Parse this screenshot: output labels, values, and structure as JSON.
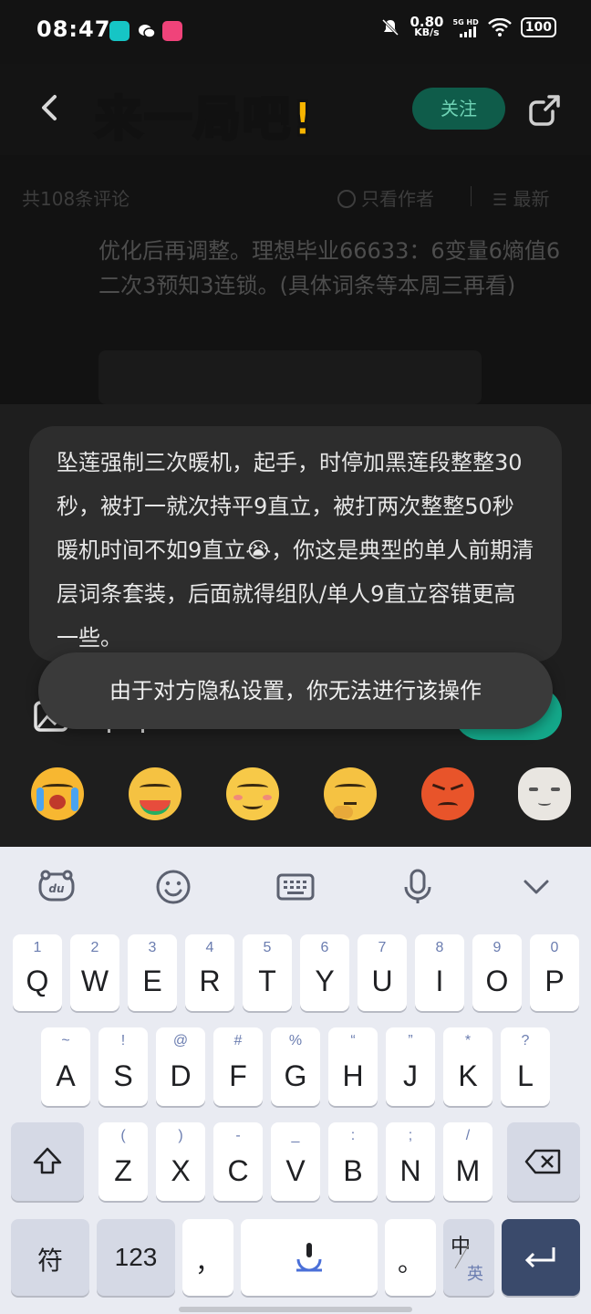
{
  "status_bar": {
    "time": "08:47",
    "net_speed_value": "0.80",
    "net_speed_unit": "KB/s",
    "signal_label": "5G HD",
    "battery": "100"
  },
  "header": {
    "overlay_title": "来一局吧!",
    "follow_label": "关注"
  },
  "comments": {
    "count_label": "共108条评论",
    "only_author_label": "只看作者",
    "sort_label": "最新",
    "comment_text": "优化后再调整。理想毕业66633：6变量6熵值6二次3预知3连锁。(具体词条等本周三再看)"
  },
  "reply_sheet": {
    "quoted_text": "坠莲强制三次暖机，起手，时停加黑莲段整整30秒，被打一就次持平9直立，被打两次整整50秒暖机时间不如9直立😭，你这是典型的单人前期清层词条套装，后面就得组队/单人9直立容错更高一些。",
    "toast": "由于对方隐私设置，你无法进行该操作",
    "emojis": [
      {
        "icon": "crying-face",
        "color": "#f7b731"
      },
      {
        "icon": "eating-watermelon-face",
        "color": "#f5c242"
      },
      {
        "icon": "smug-face",
        "color": "#f7c948"
      },
      {
        "icon": "thinking-face",
        "color": "#f5c242"
      },
      {
        "icon": "angry-face",
        "color": "#e8542a"
      },
      {
        "icon": "cat-face",
        "color": "#e9e6e1"
      }
    ]
  },
  "keyboard": {
    "toolbar": [
      "du-logo-icon",
      "emoji-icon",
      "keyboard-icon",
      "microphone-icon",
      "chevron-down-icon"
    ],
    "row1": [
      {
        "main": "Q",
        "sub": "1"
      },
      {
        "main": "W",
        "sub": "2"
      },
      {
        "main": "E",
        "sub": "3"
      },
      {
        "main": "R",
        "sub": "4"
      },
      {
        "main": "T",
        "sub": "5"
      },
      {
        "main": "Y",
        "sub": "6"
      },
      {
        "main": "U",
        "sub": "7"
      },
      {
        "main": "I",
        "sub": "8"
      },
      {
        "main": "O",
        "sub": "9"
      },
      {
        "main": "P",
        "sub": "0"
      }
    ],
    "row2": [
      {
        "main": "A",
        "sub": "~"
      },
      {
        "main": "S",
        "sub": "!"
      },
      {
        "main": "D",
        "sub": "@"
      },
      {
        "main": "F",
        "sub": "#"
      },
      {
        "main": "G",
        "sub": "%"
      },
      {
        "main": "H",
        "sub": "“"
      },
      {
        "main": "J",
        "sub": "”"
      },
      {
        "main": "K",
        "sub": "*"
      },
      {
        "main": "L",
        "sub": "?"
      }
    ],
    "row3": [
      {
        "main": "Z",
        "sub": "("
      },
      {
        "main": "X",
        "sub": ")"
      },
      {
        "main": "C",
        "sub": "-"
      },
      {
        "main": "V",
        "sub": "_"
      },
      {
        "main": "B",
        "sub": ":"
      },
      {
        "main": "N",
        "sub": ";"
      },
      {
        "main": "M",
        "sub": "/"
      }
    ],
    "symbol_label": "符",
    "number_label": "123",
    "comma_label": "，",
    "period_label": "。",
    "lang_cn": "中",
    "lang_en": "英"
  }
}
